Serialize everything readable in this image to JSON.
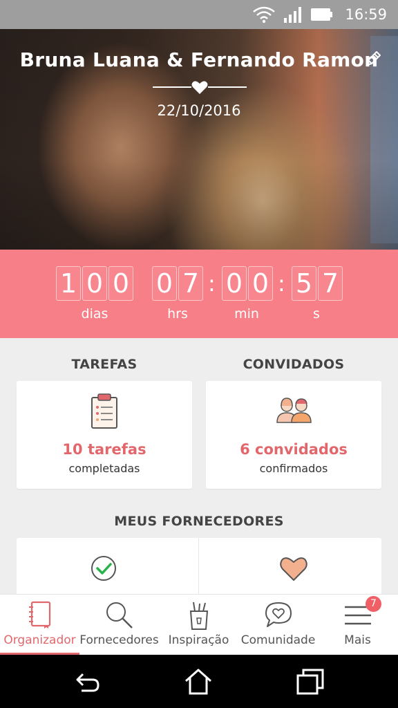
{
  "status_bar": {
    "time": "16:59"
  },
  "hero": {
    "couple_names": "Bruna Luana & Fernando Ramon",
    "wedding_date": "22/10/2016"
  },
  "countdown": {
    "days": [
      "1",
      "0",
      "0"
    ],
    "hours": [
      "0",
      "7"
    ],
    "minutes": [
      "0",
      "0"
    ],
    "seconds": [
      "5",
      "7"
    ],
    "labels": {
      "days": "dias",
      "hours": "hrs",
      "minutes": "min",
      "seconds": "s"
    }
  },
  "tasks": {
    "title": "TAREFAS",
    "count": "10 tarefas",
    "sub": "completadas"
  },
  "guests": {
    "title": "CONVIDADOS",
    "count": "6 convidados",
    "sub": "confirmados"
  },
  "vendors": {
    "title": "MEUS FORNECEDORES"
  },
  "bottom_nav": {
    "items": [
      {
        "label": "Organizador",
        "icon": "notebook-icon",
        "active": true
      },
      {
        "label": "Fornecedores",
        "icon": "search-icon",
        "active": false
      },
      {
        "label": "Inspiração",
        "icon": "inspiration-cup-icon",
        "active": false
      },
      {
        "label": "Comunidade",
        "icon": "chat-heart-icon",
        "active": false
      },
      {
        "label": "Mais",
        "icon": "menu-icon",
        "active": false
      }
    ],
    "badge": "7"
  },
  "colors": {
    "accent": "#e2676c",
    "countdown_bg": "#f77f87",
    "content_bg": "#eeeeee"
  }
}
